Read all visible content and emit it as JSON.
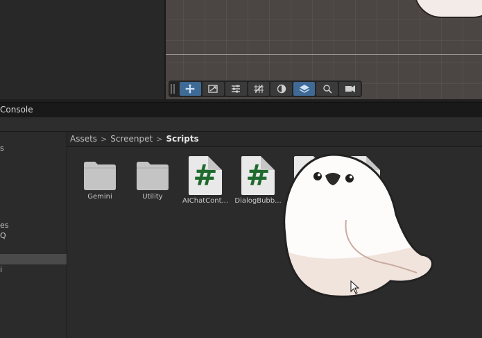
{
  "left_panel_labels": [
    "s",
    "es",
    "Q",
    "i"
  ],
  "scene": {
    "toolbar_tools": [
      {
        "icon": "move-tool-icon",
        "active": true
      },
      {
        "icon": "rect-transform-icon",
        "active": false
      },
      {
        "icon": "sliders-icon",
        "active": false
      },
      {
        "icon": "grid-snap-icon",
        "active": false
      },
      {
        "icon": "shading-mode-icon",
        "active": false
      },
      {
        "icon": "layers-icon",
        "active": true
      },
      {
        "icon": "search-icon",
        "active": false
      },
      {
        "icon": "camera-icon",
        "active": false
      }
    ],
    "accent_color": "#3f6a95"
  },
  "console": {
    "tab_label": "Console"
  },
  "breadcrumb": {
    "part1": "Assets",
    "part2": "Screenpet",
    "part3": "Scripts"
  },
  "assets": [
    {
      "label": "Gemini",
      "type": "folder"
    },
    {
      "label": "Utility",
      "type": "folder"
    },
    {
      "label": "AIChatCont...",
      "type": "script"
    },
    {
      "label": "DialogBubb...",
      "type": "script"
    }
  ],
  "script_glyph": "#"
}
